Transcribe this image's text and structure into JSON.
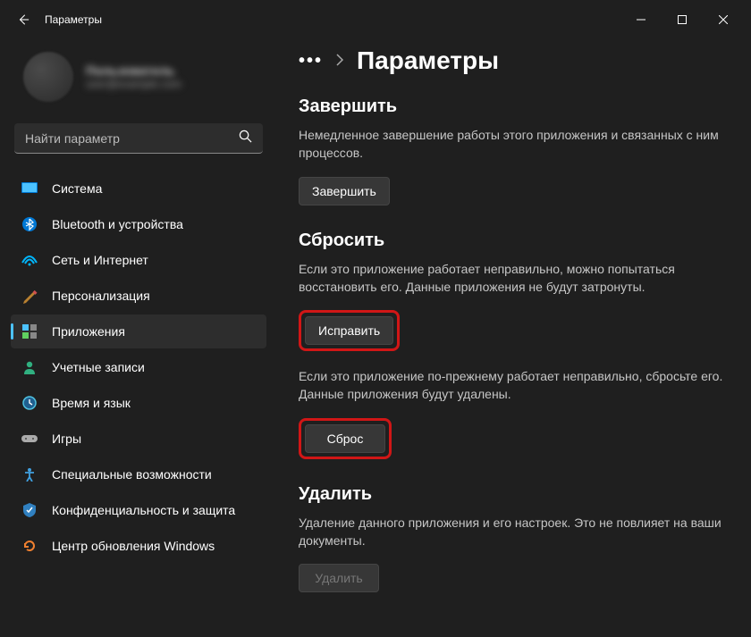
{
  "window": {
    "title": "Параметры"
  },
  "user": {
    "name": "Пользователь",
    "email": "user@example.com"
  },
  "search": {
    "placeholder": "Найти параметр"
  },
  "sidebar": {
    "items": [
      {
        "label": "Система",
        "icon": "system"
      },
      {
        "label": "Bluetooth и устройства",
        "icon": "bluetooth"
      },
      {
        "label": "Сеть и Интернет",
        "icon": "network"
      },
      {
        "label": "Персонализация",
        "icon": "personalize"
      },
      {
        "label": "Приложения",
        "icon": "apps",
        "active": true
      },
      {
        "label": "Учетные записи",
        "icon": "accounts"
      },
      {
        "label": "Время и язык",
        "icon": "time"
      },
      {
        "label": "Игры",
        "icon": "gaming"
      },
      {
        "label": "Специальные возможности",
        "icon": "accessibility"
      },
      {
        "label": "Конфиденциальность и защита",
        "icon": "privacy"
      },
      {
        "label": "Центр обновления Windows",
        "icon": "update"
      }
    ]
  },
  "breadcrumb": {
    "title": "Параметры"
  },
  "sections": {
    "terminate": {
      "heading": "Завершить",
      "desc": "Немедленное завершение работы этого приложения и связанных с ним процессов.",
      "button": "Завершить"
    },
    "reset": {
      "heading": "Сбросить",
      "desc1": "Если это приложение работает неправильно, можно попытаться восстановить его. Данные приложения не будут затронуты.",
      "button1": "Исправить",
      "desc2": "Если это приложение по-прежнему работает неправильно, сбросьте его. Данные приложения будут удалены.",
      "button2": "Сброс"
    },
    "uninstall": {
      "heading": "Удалить",
      "desc": "Удаление данного приложения и его настроек. Это не повлияет на ваши документы.",
      "button": "Удалить"
    }
  }
}
